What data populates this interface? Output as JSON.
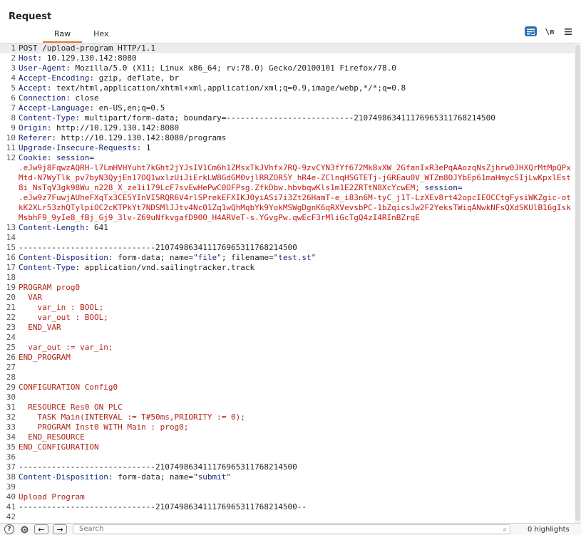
{
  "panel": {
    "title": "Request"
  },
  "tabs": [
    {
      "label": "Raw"
    },
    {
      "label": "Hex"
    }
  ],
  "toolbar": {
    "wrap_icon": "pretty-print-icon",
    "newline_label": "\\n",
    "menu_icon": "hamburger-menu-icon"
  },
  "lines": [
    {
      "n": "1",
      "text": "POST /upload-program HTTP/1.1"
    },
    {
      "n": "2",
      "name": "Host",
      "value": ": 10.129.130.142:8080"
    },
    {
      "n": "3",
      "name": "User-Agent",
      "value": ": Mozilla/5.0 (X11; Linux x86_64; rv:78.0) Gecko/20100101 Firefox/78.0"
    },
    {
      "n": "4",
      "name": "Accept-Encoding",
      "value": ": gzip, deflate, br"
    },
    {
      "n": "5",
      "name": "Accept",
      "value": ": text/html,application/xhtml+xml,application/xml;q=0.9,image/webp,*/*;q=0.8"
    },
    {
      "n": "6",
      "name": "Connection",
      "value": ": close"
    },
    {
      "n": "7",
      "name": "Accept-Language",
      "value": ": en-US,en;q=0.5"
    },
    {
      "n": "8",
      "name": "Content-Type",
      "value": ": multipart/form-data; boundary=---------------------------210749863411176965311768214500"
    },
    {
      "n": "9",
      "name": "Origin",
      "value": ": http://10.129.130.142:8080"
    },
    {
      "n": "10",
      "name": "Referer",
      "value": ": http://10.129.130.142:8080/programs"
    },
    {
      "n": "11",
      "name": "Upgrade-Insecure-Requests",
      "value": ": 1"
    },
    {
      "n": "12",
      "name": "Cookie",
      "value": ":",
      "cookie_name1": "session=",
      "cookie_val1": ".eJw9j8FqwzAQRH-l7LmHVHYuht7kGht2jYJsIV1Cm6h1ZMsxTkJVhfx7RQ-9zvCYN3fYf672MkBxXW_2GfanIxR3ePqAAozqNsZjhrw0JHXQrMtMpQPxMtd-N7WyTlk_pv7byN3QyjEn17OQ1wxlzUiJiErkLW8GdGM0vjlRRZOR5Y_hR4e-ZClnqHSGTETj-jGREau0V_WTZm8OJYbEp61maHmycSIjLwKpxlEst8i_NsTqV3gk98Wu_n228_X_ze1i179LcF7svEwHePwC0OFPsg.ZfkDbw.hbvbqwKls1m1E2ZRTtN8XcYcwEM;",
      "cookie_name2": "session=",
      "cookie_val2": ".eJw9z7FuwjAUheFXqTx3CE5YInVI5RQR6V4rlSPrekEFXIKJ0yiASi7i3Zt26HamT-e_i83n6M-tyC_j1T-LzXEv8rt42opcIEOCCtgFysiWKZgic-otkK2XLr53zhQTylpiOC2cKTPkYt7NDSMlJJtv4Nc01Zq1wQhMqbYk9YokMSWgDgnK6qRXVevsbPC-1bZqicsJw2F2YeksTWiqANwkNFsQXdSKUlB16gIskMsbhF9_9yIe8_fBj_Gj9_3lv-Z69uNfkvgafD900_H4ARVeT-s.YGvgPw.qwEcF3rMliGcTgQ4zI4RInBZrqE"
    },
    {
      "n": "13",
      "name": "Content-Length",
      "value": ": 641"
    },
    {
      "n": "14",
      "text": ""
    },
    {
      "n": "15",
      "text": "-----------------------------210749863411176965311768214500"
    },
    {
      "n": "16",
      "name": "Content-Disposition",
      "value": ": form-data; name=",
      "q1": "\"file\"",
      "mid": "; filename=",
      "q2": "\"test.st\""
    },
    {
      "n": "17",
      "name": "Content-Type",
      "value": ": application/vnd.sailingtracker.track"
    },
    {
      "n": "18",
      "text": ""
    },
    {
      "n": "19",
      "red": "PROGRAM prog0"
    },
    {
      "n": "20",
      "red": "  VAR"
    },
    {
      "n": "21",
      "red": "    var_in : BOOL;"
    },
    {
      "n": "22",
      "red": "    var_out : BOOL;"
    },
    {
      "n": "23",
      "red": "  END_VAR"
    },
    {
      "n": "24",
      "text": ""
    },
    {
      "n": "25",
      "red": "  var_out := var_in;"
    },
    {
      "n": "26",
      "red": "END_PROGRAM"
    },
    {
      "n": "27",
      "text": ""
    },
    {
      "n": "28",
      "text": ""
    },
    {
      "n": "29",
      "red": "CONFIGURATION Config0"
    },
    {
      "n": "30",
      "text": ""
    },
    {
      "n": "31",
      "red": "  RESOURCE Res0 ON PLC"
    },
    {
      "n": "32",
      "red": "    TASK Main(INTERVAL := T#50ms,PRIORITY := 0);"
    },
    {
      "n": "33",
      "red": "    PROGRAM Inst0 WITH Main : prog0;"
    },
    {
      "n": "34",
      "red": "  END_RESOURCE"
    },
    {
      "n": "35",
      "red": "END_CONFIGURATION"
    },
    {
      "n": "36",
      "text": ""
    },
    {
      "n": "37",
      "text": "-----------------------------210749863411176965311768214500"
    },
    {
      "n": "38",
      "name": "Content-Disposition",
      "value": ": form-data; name=",
      "q1": "\"submit\""
    },
    {
      "n": "39",
      "text": ""
    },
    {
      "n": "40",
      "red": "Upload Program"
    },
    {
      "n": "41",
      "text": "-----------------------------210749863411176965311768214500--"
    },
    {
      "n": "42",
      "text": ""
    }
  ],
  "bottom": {
    "help_icon": "help-icon",
    "settings_icon": "gear-icon",
    "back_label": "←",
    "forward_label": "→",
    "search_placeholder": "Search",
    "highlights_label": "0 highlights"
  }
}
